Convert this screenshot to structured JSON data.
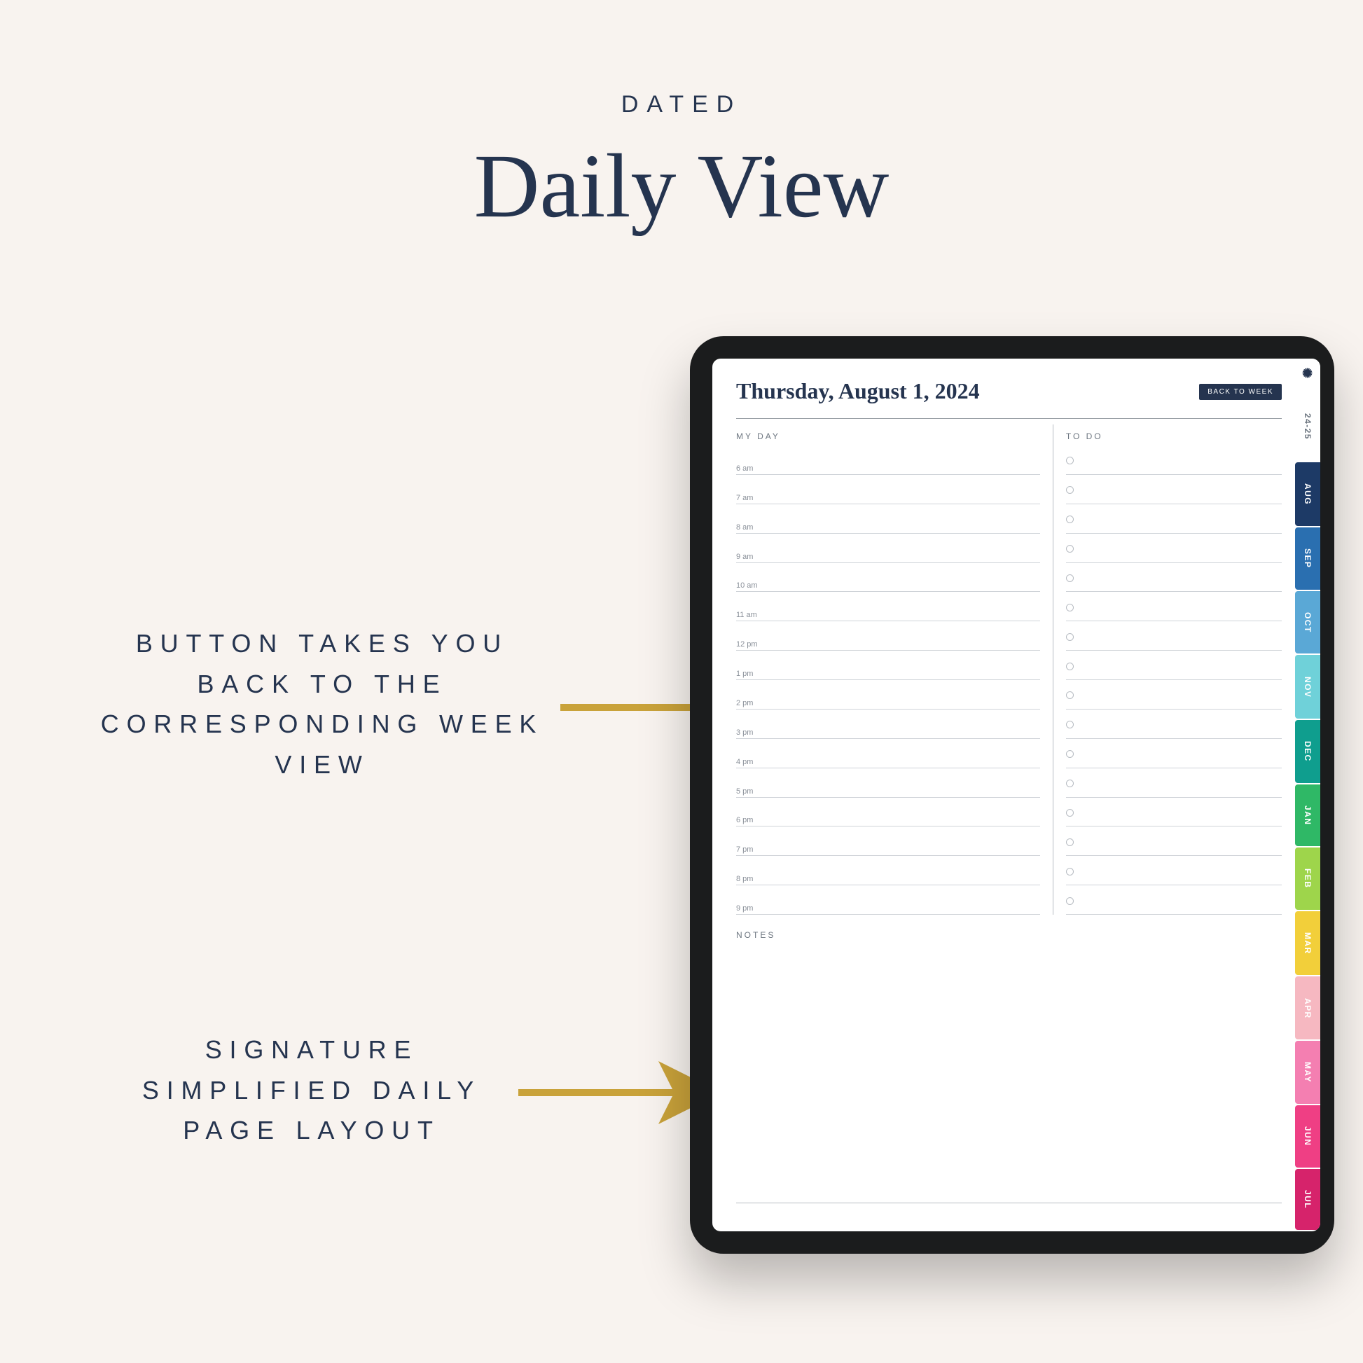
{
  "title": {
    "eyebrow": "DATED",
    "headline": "Daily View"
  },
  "callouts": {
    "back_button": "BUTTON TAKES YOU BACK TO THE CORRESPONDING WEEK VIEW",
    "layout": "SIGNATURE SIMPLIFIED DAILY PAGE LAYOUT"
  },
  "planner": {
    "date": "Thursday, August 1, 2024",
    "back_label": "BACK TO WEEK",
    "myday_label": "MY DAY",
    "todo_label": "TO DO",
    "notes_label": "NOTES",
    "hours": [
      "6 am",
      "7 am",
      "8 am",
      "9 am",
      "10 am",
      "11 am",
      "12 pm",
      "1 pm",
      "2 pm",
      "3 pm",
      "4 pm",
      "5 pm",
      "6 pm",
      "7 pm",
      "8 pm",
      "9 pm"
    ],
    "todo_count": 16,
    "tabs": [
      {
        "label": "24-25",
        "color": "#ffffff",
        "text": "#6d7680"
      },
      {
        "label": "AUG",
        "color": "#1d3a66"
      },
      {
        "label": "SEP",
        "color": "#2a6fb0"
      },
      {
        "label": "OCT",
        "color": "#5aa8d6"
      },
      {
        "label": "NOV",
        "color": "#6fd1d9"
      },
      {
        "label": "DEC",
        "color": "#0f9e8e"
      },
      {
        "label": "JAN",
        "color": "#2fb866"
      },
      {
        "label": "FEB",
        "color": "#9ed54b"
      },
      {
        "label": "MAR",
        "color": "#f2cf3a"
      },
      {
        "label": "APR",
        "color": "#f6b8c1"
      },
      {
        "label": "MAY",
        "color": "#f47fb1"
      },
      {
        "label": "JUN",
        "color": "#ef3f84"
      },
      {
        "label": "JUL",
        "color": "#d6236b"
      }
    ]
  },
  "colors": {
    "arrow": "#c9a23a"
  }
}
